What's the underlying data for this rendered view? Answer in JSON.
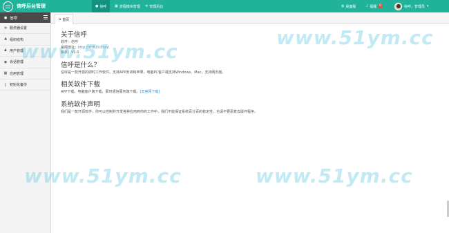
{
  "app": {
    "title": "信呼后台管理"
  },
  "topnav": [
    {
      "label": "信呼",
      "icon": "chat-icon",
      "active": true
    },
    {
      "label": "流程模块管理",
      "icon": "grid-icon",
      "active": false
    },
    {
      "label": "管理后台",
      "icon": "gear-icon",
      "active": false
    }
  ],
  "topright": {
    "homepage": "桌面版",
    "alerts_label": "提醒",
    "alerts_count": "0",
    "user": "信呼，管理员",
    "caret": "▾"
  },
  "sidebar": {
    "header": "信呼",
    "items": [
      {
        "label": "服务器设置",
        "icon": "gear-icon"
      },
      {
        "label": "组织结构",
        "icon": "org-icon"
      },
      {
        "label": "用户管理",
        "icon": "user-icon"
      },
      {
        "label": "会话管理",
        "icon": "chat-icon"
      },
      {
        "label": "应用管理",
        "icon": "grid-icon"
      },
      {
        "label": "初始化备份",
        "icon": "file-icon"
      }
    ]
  },
  "tabs": [
    {
      "label": "首页",
      "icon": "home-icon"
    }
  ],
  "main": {
    "about_title": "关于信呼",
    "software_line": "软件：信呼",
    "website_label": "官网地址：",
    "website_url": "http://xh829.com/",
    "version_line": "版本：V1.0",
    "what_title": "信呼是什么？",
    "what_text": "信呼是一款开源的即时工作软件。支持APP安卓和苹果，电脑PC客户端支持Windows、Mac，支持网页版。",
    "download_title": "相关软件下载",
    "download_text": "APP下载，电脑客户端下载，即时通信服务端下载。",
    "download_link": "[去官网下载]",
    "statement_title": "系统软件声明",
    "statement_text": "我们是一款开源软件，你可以控制并开发各种应用到你的工作中，我们不能保证系统百分百的稳定性，也请不要恶意去破坏程序。"
  },
  "watermarks": [
    "www.51ym.cc",
    "www.51ym.cc",
    "www.51ym.cc",
    "www.51ym.cc"
  ],
  "colors": {
    "topbar": "#20b29b",
    "sidebar_header": "#4a4a4a",
    "link": "#3a8fd0",
    "badge": "#e74c3c"
  }
}
